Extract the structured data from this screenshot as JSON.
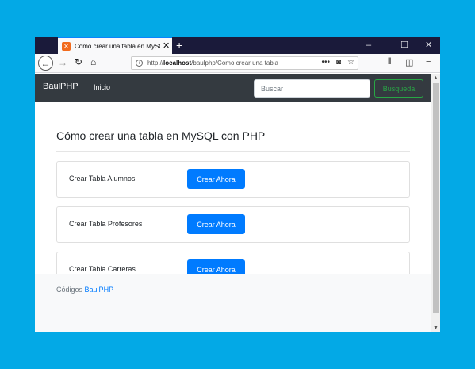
{
  "browser": {
    "tab": {
      "favicon": "xampp-icon",
      "title": "Cómo crear una tabla en MySQL",
      "close": "✕"
    },
    "new_tab": "+",
    "window_controls": {
      "minimize": "–",
      "maximize": "☐",
      "close": "✕"
    },
    "url": {
      "prefix": "http://",
      "host": "localhost",
      "path": "/baulphp/Como crear una tabla"
    },
    "icons": [
      "back-arrow-icon",
      "forward-arrow-icon",
      "reload-icon",
      "home-icon",
      "info-icon",
      "more-icon",
      "pocket-icon",
      "bookmark-star-icon",
      "library-icon",
      "sidebar-icon",
      "menu-icon"
    ]
  },
  "site": {
    "brand": "BaulPHP",
    "nav_link": "Inicio",
    "search": {
      "placeholder": "Buscar",
      "button": "Busqueda"
    }
  },
  "main": {
    "title": "Cómo crear una tabla en MySQL con PHP",
    "cards": [
      {
        "label": "Crear Tabla Alumnos",
        "button": "Crear Ahora"
      },
      {
        "label": "Crear Tabla Profesores",
        "button": "Crear Ahora"
      },
      {
        "label": "Crear Tabla Carreras",
        "button": "Crear Ahora"
      }
    ]
  },
  "footer": {
    "text": "Códigos",
    "link": "BaulPHP"
  },
  "colors": {
    "background": "#03a9e6",
    "tabbar": "#1a1a3a",
    "site_nav": "#343a40",
    "primary": "#007bff",
    "success": "#28a745",
    "footer_bg": "#f8f9fa"
  }
}
